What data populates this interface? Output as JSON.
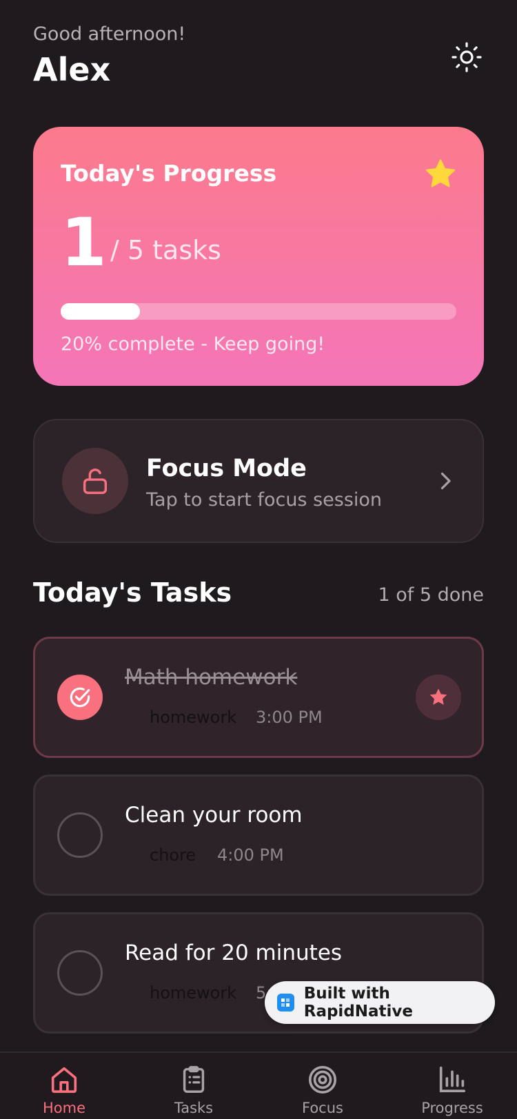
{
  "header": {
    "greeting": "Good afternoon!",
    "name": "Alex",
    "theme_icon": "sun-icon"
  },
  "progress": {
    "title": "Today's Progress",
    "completed": "1",
    "total_label": "/ 5 tasks",
    "percent": 20,
    "message": "20% complete - Keep going!",
    "star_icon": "star-icon",
    "gradient_top": "#fb7a8c",
    "gradient_bottom": "#f476b8"
  },
  "focus": {
    "title": "Focus Mode",
    "subtitle": "Tap to start focus session",
    "icon": "unlock-icon"
  },
  "tasks": {
    "heading": "Today's Tasks",
    "count_label": "1 of 5 done",
    "items": [
      {
        "title": "Math homework",
        "category": "homework",
        "time": "3:00 PM",
        "done": true,
        "favorite": true
      },
      {
        "title": "Clean your room",
        "category": "chore",
        "time": "4:00 PM",
        "done": false
      },
      {
        "title": "Read for 20 minutes",
        "category": "homework",
        "time": "5:",
        "done": false
      }
    ]
  },
  "badge": {
    "text": "Built with RapidNative"
  },
  "tabbar": {
    "items": [
      {
        "label": "Home",
        "icon": "home-icon",
        "active": true
      },
      {
        "label": "Tasks",
        "icon": "clipboard-icon",
        "active": false
      },
      {
        "label": "Focus",
        "icon": "target-icon",
        "active": false
      },
      {
        "label": "Progress",
        "icon": "bar-chart-icon",
        "active": false
      }
    ]
  },
  "colors": {
    "background": "#1e1a1e",
    "accent": "#f9707f",
    "card": "#2c2329"
  }
}
